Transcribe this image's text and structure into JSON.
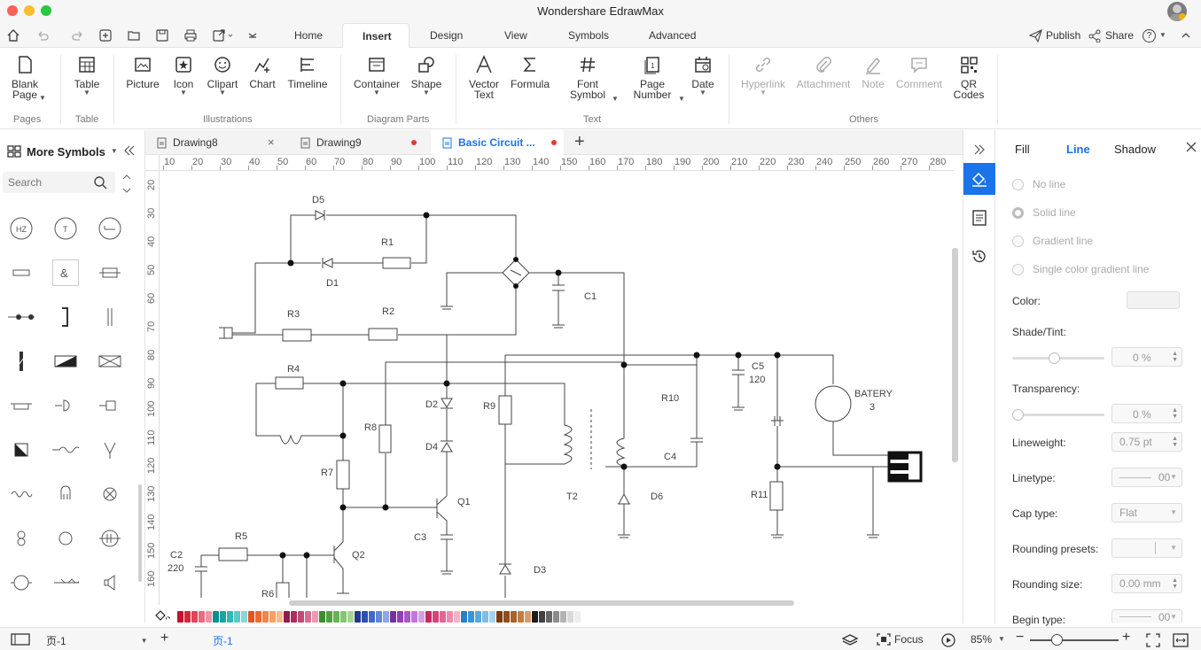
{
  "app": {
    "title": "Wondershare EdrawMax"
  },
  "menu": {
    "tabs": [
      "Home",
      "Insert",
      "Design",
      "View",
      "Symbols",
      "Advanced"
    ],
    "active_tab": "Insert",
    "publish_label": "Publish",
    "share_label": "Share",
    "help_label": "?"
  },
  "ribbon": {
    "blank_page": [
      "Blank",
      "Page"
    ],
    "table": "Table",
    "picture": "Picture",
    "icon": "Icon",
    "clipart": "Clipart",
    "chart": "Chart",
    "timeline": "Timeline",
    "container": "Container",
    "shape": "Shape",
    "vector_text": [
      "Vector",
      "Text"
    ],
    "formula": "Formula",
    "font_symbol": [
      "Font",
      "Symbol"
    ],
    "page_number": [
      "Page",
      "Number"
    ],
    "date": "Date",
    "hyperlink": "Hyperlink",
    "attachment": "Attachment",
    "note": "Note",
    "comment": "Comment",
    "qr_codes": [
      "QR",
      "Codes"
    ],
    "groups": {
      "pages": "Pages",
      "table": "Table",
      "illustrations": "Illustrations",
      "diagram_parts": "Diagram Parts",
      "text": "Text",
      "others": "Others"
    }
  },
  "library": {
    "title": "More Symbols",
    "search_placeholder": "Search"
  },
  "documents": {
    "tabs": [
      {
        "label": "Drawing8",
        "close": "×"
      },
      {
        "label": "Drawing9",
        "unsaved": true
      },
      {
        "label": "Basic Circuit ...",
        "unsaved": true
      }
    ],
    "active": "Basic Circuit ...",
    "add": "+"
  },
  "rulers": {
    "horizontal": [
      "10",
      "20",
      "30",
      "40",
      "50",
      "60",
      "70",
      "80",
      "90",
      "100",
      "110",
      "120",
      "130",
      "140",
      "150",
      "160",
      "170",
      "180",
      "190",
      "200",
      "210",
      "220",
      "230",
      "240",
      "250",
      "260",
      "270",
      "280"
    ],
    "vertical": [
      "20",
      "30",
      "40",
      "50",
      "60",
      "70",
      "80",
      "90",
      "100",
      "110",
      "120",
      "130",
      "140",
      "150",
      "160"
    ]
  },
  "circuit": {
    "labels": {
      "D5": "D5",
      "D1": "D1",
      "R1": "R1",
      "C1": "C1",
      "R3": "R3",
      "R2": "R2",
      "R4": "R4",
      "C5": "C5",
      "C5v": "120",
      "BATERY": "BATERY",
      "BATERYv": "3",
      "R10": "R10",
      "D2": "D2",
      "R9": "R9",
      "R8": "R8",
      "D4": "D4",
      "C4": "C4",
      "R7": "R7",
      "Q1": "Q1",
      "T2": "T2",
      "D6": "D6",
      "R11": "R11",
      "C3": "C3",
      "R5": "R5",
      "Q2": "Q2",
      "C2": "C2",
      "C2v": "220",
      "R6": "R6",
      "D3": "D3"
    }
  },
  "colors": {
    "accent": "#1a73e8",
    "palette": [
      "#c8102e",
      "#d7263d",
      "#e0455a",
      "#e86a7d",
      "#ef94a3",
      "#0b8f8f",
      "#1aa3a3",
      "#37b6b6",
      "#5cc8c8",
      "#86d8d8",
      "#e8531c",
      "#ee6a30",
      "#f28549",
      "#f6a067",
      "#f9bb8c",
      "#8e1c4f",
      "#a8305f",
      "#c04a76",
      "#d86d92",
      "#eb99b3",
      "#3c8d2f",
      "#4fa13f",
      "#66b454",
      "#85c66f",
      "#a6d78f",
      "#21398f",
      "#2c4fb0",
      "#4168c8",
      "#6487d7",
      "#8ea7e5",
      "#7b2f9e",
      "#9240b6",
      "#a858c9",
      "#bf7ad8",
      "#d4a0e6",
      "#c22c62",
      "#d74479",
      "#e46592",
      "#ee8bad",
      "#f5b3c9",
      "#2a7fc4",
      "#3e93d6",
      "#5aa8e2",
      "#7dbdeb",
      "#a5d2f3",
      "#7a3c12",
      "#924d1c",
      "#aa6229",
      "#c27d42",
      "#d79d6a",
      "#1b1b1b",
      "#404040",
      "#666666",
      "#8c8c8c",
      "#b3b3b3",
      "#d9d9d9",
      "#eeeeee"
    ]
  },
  "properties": {
    "tabs": [
      "Fill",
      "Line",
      "Shadow"
    ],
    "active_tab": "Line",
    "line_options": [
      "No line",
      "Solid line",
      "Gradient line",
      "Single color gradient line"
    ],
    "selected_option": "Solid line",
    "color_label": "Color:",
    "shade_label": "Shade/Tint:",
    "shade_value": "0 %",
    "shade_level": 0.45,
    "transparency_label": "Transparency:",
    "transparency_value": "0 %",
    "transparency_level": 0,
    "lineweight_label": "Lineweight:",
    "lineweight_value": "0.75 pt",
    "linetype_label": "Linetype:",
    "linetype_value": "00",
    "cap_label": "Cap type:",
    "cap_value": "Flat",
    "rounding_presets_label": "Rounding presets:",
    "rounding_size_label": "Rounding size:",
    "rounding_size_value": "0.00 mm",
    "begin_type_label": "Begin type:",
    "begin_type_value": "00"
  },
  "status": {
    "page_select": "页-1",
    "page_tab": "页-1",
    "add": "+",
    "focus_label": "Focus",
    "zoom": "85%",
    "zoom_level": 0.35
  }
}
